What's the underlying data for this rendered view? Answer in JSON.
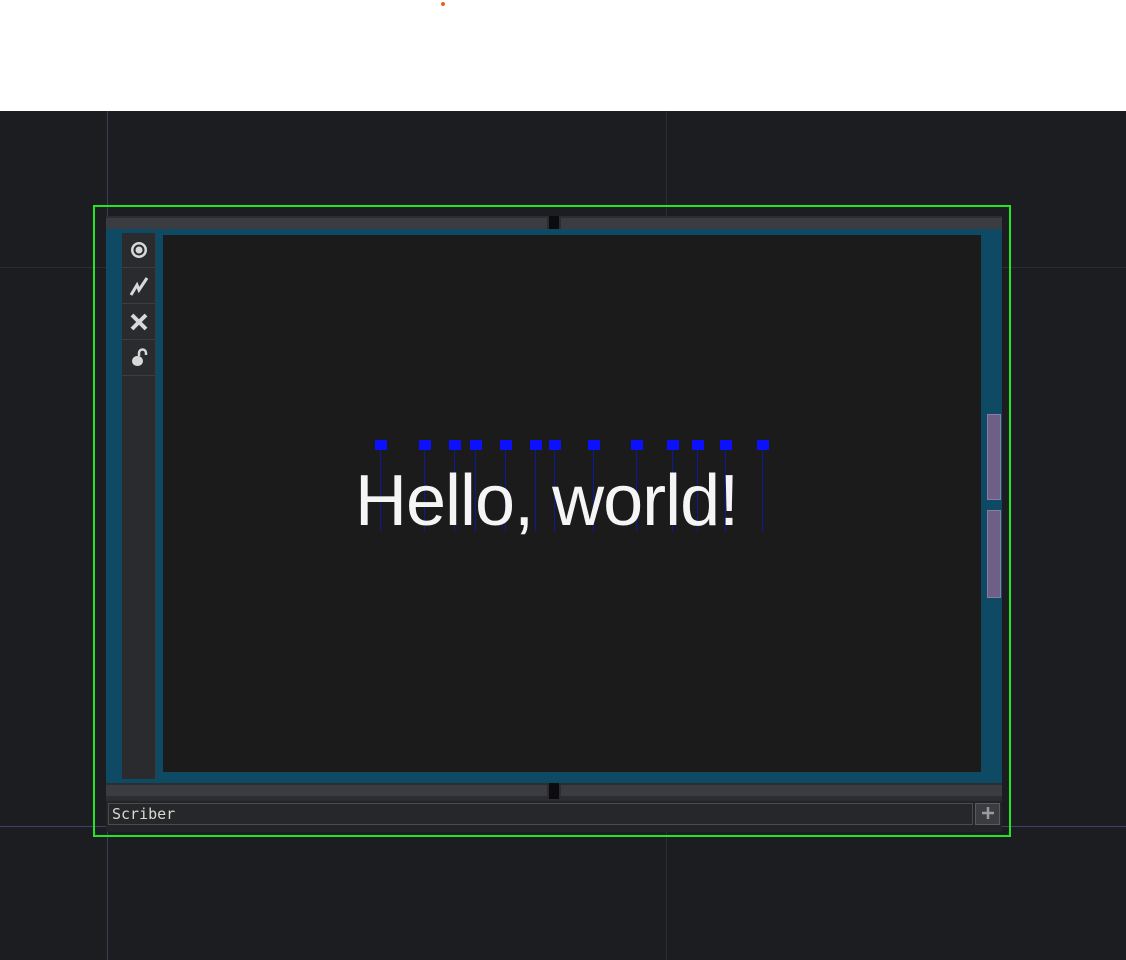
{
  "window": {
    "node_name": "Scriber"
  },
  "viewport": {
    "text": "Hello, world!"
  },
  "toolbar": {
    "buttons": [
      {
        "name": "view-icon"
      },
      {
        "name": "wire-icon"
      },
      {
        "name": "close-icon"
      },
      {
        "name": "unlock-icon"
      }
    ]
  },
  "colors": {
    "selection": "#21e621",
    "viewer_border": "#0e4a63",
    "markers": "#0b10ff",
    "scroll_thumb": "#6e5f86",
    "workspace_bg": "#1c1d20"
  }
}
